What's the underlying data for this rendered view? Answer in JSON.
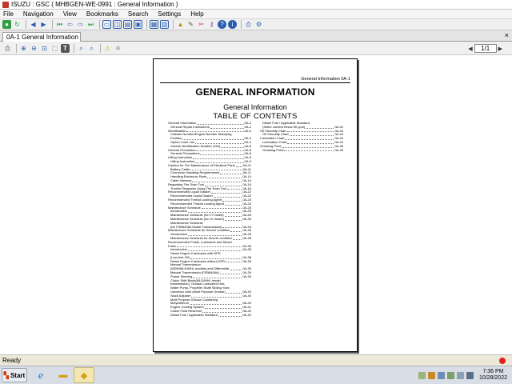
{
  "window": {
    "title": "ISUZU : GSC ( MHBGEN-WE-0991 : General Information )"
  },
  "menu": [
    "File",
    "Navigation",
    "View",
    "Bookmarks",
    "Search",
    "Settings",
    "Help"
  ],
  "tab": {
    "label": "0A-1 General Information",
    "close": "×"
  },
  "pager": {
    "value": "1/1"
  },
  "page": {
    "running_header": "General Information   0A-1",
    "title": "GENERAL INFORMATION",
    "subtitle": "General Information",
    "toc_title": "TABLE OF CONTENTS",
    "toc_left": [
      {
        "t": "General Information",
        "p": "0A-2"
      },
      {
        "t": "General Repair Instructions",
        "p": "0A-2",
        "sub": true
      },
      {
        "t": "Identification",
        "p": "0A-3"
      },
      {
        "t": "Chassis Number/Engine Number Stamping",
        "p": "",
        "sub": true
      },
      {
        "t": "Position",
        "p": "0A-3",
        "sub": true
      },
      {
        "t": "Option Code List",
        "p": "0A-4",
        "sub": true
      },
      {
        "t": "Vehicle Identification Number (VIN)",
        "p": "0A-6",
        "sub": true
      },
      {
        "t": "General Precaution",
        "p": "0A-8"
      },
      {
        "t": "General Precautions",
        "p": "0A-8",
        "sub": true
      },
      {
        "t": "Lifting Instruction",
        "p": "0A-9"
      },
      {
        "t": "Lifting Instruction",
        "p": "0A-9",
        "sub": true
      },
      {
        "t": "Caution for The Maintenance of Electrical Parts",
        "p": "0A-11"
      },
      {
        "t": "Battery Cable",
        "p": "0A-11",
        "sub": true
      },
      {
        "t": "Connector Handling Requirements",
        "p": "0A-11",
        "sub": true
      },
      {
        "t": "Handling Electronic Parts",
        "p": "0A-14",
        "sub": true
      },
      {
        "t": "Cable Harness",
        "p": "0A-14",
        "sub": true
      },
      {
        "t": "Regarding The Scan Tool",
        "p": "0A-16"
      },
      {
        "t": "Trouble Diagnosis Using The Scan Tool",
        "p": "0A-16",
        "sub": true
      },
      {
        "t": "Recommended Liquid Gasket",
        "p": "0A-22"
      },
      {
        "t": "Recommended Liquid Gasket",
        "p": "0A-22",
        "sub": true
      },
      {
        "t": "Recommended Thread Locking Agent",
        "p": "0A-24"
      },
      {
        "t": "Recommended Thread Locking Agent",
        "p": "0A-24",
        "sub": true
      },
      {
        "t": "Maintenance Schedule",
        "p": "0A-25"
      },
      {
        "t": "Introduction",
        "p": "0A-25",
        "sub": true
      },
      {
        "t": "Maintenance Schedule (for LT model)",
        "p": "0A-26",
        "sub": true
      },
      {
        "t": "Maintenance Schedule (for LV model)",
        "p": "0A-30",
        "sub": true
      },
      {
        "t": "Maintenance Schedule",
        "p": "",
        "sub": true
      },
      {
        "t": "(for FSB6406A Model Transmission)",
        "p": "0A-34",
        "sub": true
      },
      {
        "t": "Maintenance Schedule for Severe condition",
        "p": "0A-35"
      },
      {
        "t": "Introduction",
        "p": "0A-35",
        "sub": true
      },
      {
        "t": "Maintenance Schedule for Severe condition",
        "p": "0A-35",
        "sub": true
      },
      {
        "t": "Recommended Fluids, Lubricants and Diesel",
        "p": ""
      },
      {
        "t": "Fuels",
        "p": "0A-38"
      },
      {
        "t": "Introduction",
        "p": "0A-38",
        "sub": true
      },
      {
        "t": "Diesel Engine Crankcase with DPD",
        "p": "",
        "sub": true
      },
      {
        "t": "(Low Ash Oil)",
        "p": "0A-38",
        "sub": true
      },
      {
        "t": "Diesel Engine Crankcase without DPD",
        "p": "0A-39",
        "sub": true
      },
      {
        "t": "Manual Transmission",
        "p": "",
        "sub": true
      },
      {
        "t": "(MZW/MLD/MHL models) and Differential",
        "p": "0A-39",
        "sub": true
      },
      {
        "t": "Manual Transmission (FSB6406A)",
        "p": "0A-39",
        "sub": true
      },
      {
        "t": "Power Steering",
        "p": "0A-39",
        "sub": true
      },
      {
        "t": "Clutch Shift Block(MLD/MHL model",
        "p": "",
        "sub": true
      },
      {
        "t": "transmission), Grease Lubricated Hub,",
        "p": "",
        "sub": true
      },
      {
        "t": "Water Pump, Propeller Shaft Sliding Yoke,",
        "p": "",
        "sub": true
      },
      {
        "t": "Universal Joint (Multi Purpose Grease)",
        "p": "0A-40",
        "sub": true
      },
      {
        "t": "Slack Adjuster",
        "p": "0A-40",
        "sub": true
      },
      {
        "t": "Multi Purpose Grease Containing",
        "p": "",
        "sub": true
      },
      {
        "t": "Molybdenum",
        "p": "0A-40",
        "sub": true
      },
      {
        "t": "Engine Cooling System",
        "p": "0A-41",
        "sub": true
      },
      {
        "t": "Clutch Fluid Reservoir",
        "p": "0A-42",
        "sub": true
      },
      {
        "t": "Diesel Fuel / Applicable Standard",
        "p": "0A-42",
        "sub": true
      }
    ],
    "toc_right": [
      {
        "t": "Diesel Fuel / Applicable Standard",
        "p": "",
        "sub": true
      },
      {
        "t": "(Sulfur content below 50 ppm)",
        "p": "0A-42",
        "sub": true
      },
      {
        "t": "Oil Viscosity Chart",
        "p": "0A-43"
      },
      {
        "t": "Oil Viscosity Chart",
        "p": "0A-43",
        "sub": true
      },
      {
        "t": "Lubrication Chart",
        "p": "0A-44"
      },
      {
        "t": "Lubrication Chart",
        "p": "0A-44",
        "sub": true
      },
      {
        "t": "Greasing Point",
        "p": "0A-46"
      },
      {
        "t": "Greasing Point",
        "p": "0A-46",
        "sub": true
      }
    ]
  },
  "status": {
    "text": "Ready"
  },
  "taskbar": {
    "start": "Start",
    "time": "7:36 PM",
    "date": "10/28/2022"
  },
  "icons": {
    "app": "isuzu-app-icon",
    "record_color": "#e0201b",
    "accent": "#2a5db0"
  }
}
